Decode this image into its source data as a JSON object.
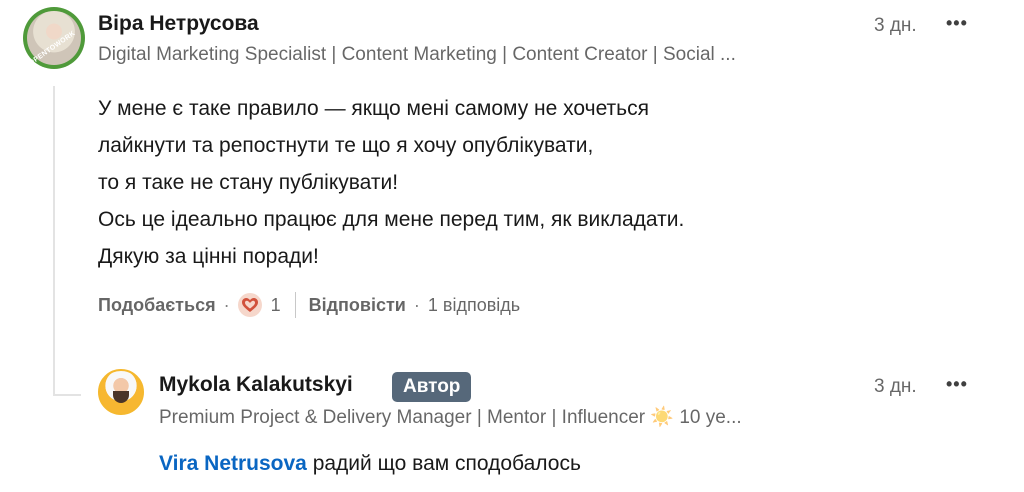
{
  "comment": {
    "author_name": "Віра Нетрусова",
    "author_headline": "Digital Marketing Specialist | Content Marketing | Content Creator | Social ...",
    "avatar_badge_text": "OPENTOWORK",
    "time": "3 дн.",
    "more_icon": "ellipsis-icon",
    "body_lines": [
      "У мене є таке правило — якщо мені самому не хочеться",
      "лайкнути та репостнути те що я хочу опублікувати,",
      "то я таке не стану публікувати!",
      "Ось це ідеально працює для мене перед тим, як викладати.",
      "Дякую за цінні поради!"
    ],
    "actions": {
      "like_label": "Подобається",
      "reaction_icon": "heart-icon",
      "reaction_count": "1",
      "reply_label": "Відповісти",
      "replies_text": "1 відповідь"
    }
  },
  "reply": {
    "author_name": "Mykola Kalakutskyi",
    "author_badge": "Автор",
    "author_headline": "Premium Project & Delivery Manager | Mentor | Influencer ☀️ 10 ye...",
    "time": "3 дн.",
    "mention": "Vira Netrusova",
    "text": " радий що вам сподобалось"
  },
  "colors": {
    "link_blue": "#0a66c2",
    "badge_bg": "#56687a",
    "heart_red": "#d1513b",
    "opentowork_green": "#4f9a3a"
  }
}
